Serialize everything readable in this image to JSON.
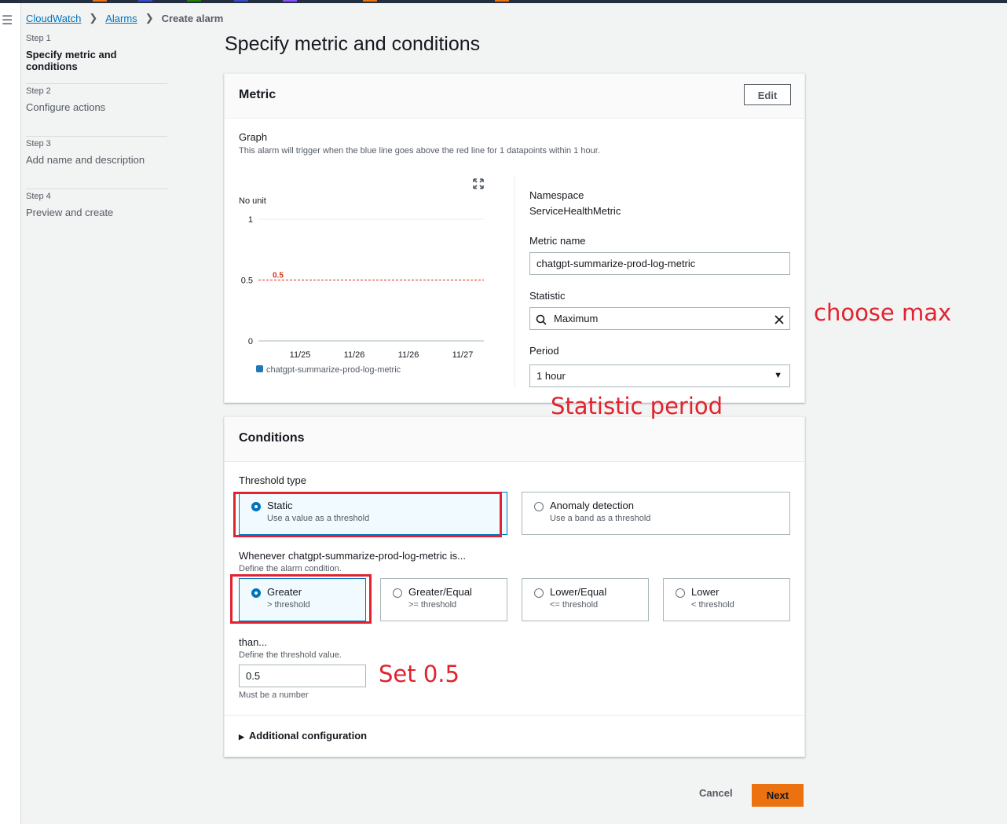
{
  "breadcrumb": {
    "item1": "CloudWatch",
    "item2": "Alarms",
    "current": "Create alarm"
  },
  "steps": [
    {
      "num": "Step 1",
      "label": "Specify metric and conditions"
    },
    {
      "num": "Step 2",
      "label": "Configure actions"
    },
    {
      "num": "Step 3",
      "label": "Add name and description"
    },
    {
      "num": "Step 4",
      "label": "Preview and create"
    }
  ],
  "page_title": "Specify metric and conditions",
  "metric_panel": {
    "title": "Metric",
    "edit_label": "Edit",
    "graph_title": "Graph",
    "graph_desc": "This alarm will trigger when the blue line goes above the red line for 1 datapoints within 1 hour.",
    "namespace_label": "Namespace",
    "namespace_value": "ServiceHealthMetric",
    "metric_name_label": "Metric name",
    "metric_name_value": "chatgpt-summarize-prod-log-metric",
    "statistic_label": "Statistic",
    "statistic_value": "Maximum",
    "period_label": "Period",
    "period_value": "1 hour"
  },
  "chart_data": {
    "type": "line",
    "ylabel": "No unit",
    "yticks": [
      "1",
      "0.5",
      "0"
    ],
    "ylim": [
      0,
      1
    ],
    "x_categories": [
      "11/25",
      "11/26",
      "11/26",
      "11/27"
    ],
    "threshold": 0.5,
    "threshold_label": "0.5",
    "threshold_color": "#d13212",
    "series": [
      {
        "name": "chatgpt-summarize-prod-log-metric",
        "color": "#1f77b4",
        "values": []
      }
    ],
    "grid": true,
    "legend": "bottom-left"
  },
  "conditions_panel": {
    "title": "Conditions",
    "threshold_type_label": "Threshold type",
    "static_title": "Static",
    "static_desc": "Use a value as a threshold",
    "anomaly_title": "Anomaly detection",
    "anomaly_desc": "Use a band as a threshold",
    "whenever_label": "Whenever chatgpt-summarize-prod-log-metric is...",
    "whenever_desc": "Define the alarm condition.",
    "options": [
      {
        "title": "Greater",
        "desc": "> threshold"
      },
      {
        "title": "Greater/Equal",
        "desc": ">= threshold"
      },
      {
        "title": "Lower/Equal",
        "desc": "<= threshold"
      },
      {
        "title": "Lower",
        "desc": "< threshold"
      }
    ],
    "than_label": "than...",
    "than_desc": "Define the threshold value.",
    "threshold_value": "0.5",
    "must_be_number": "Must be a number",
    "additional_config": "Additional configuration"
  },
  "annotations": {
    "choose_max": "choose max",
    "statistic_period": "Statistic period",
    "set_value": "Set 0.5",
    "color": "#e0232e"
  },
  "footer": {
    "cancel_label": "Cancel",
    "next_label": "Next"
  }
}
